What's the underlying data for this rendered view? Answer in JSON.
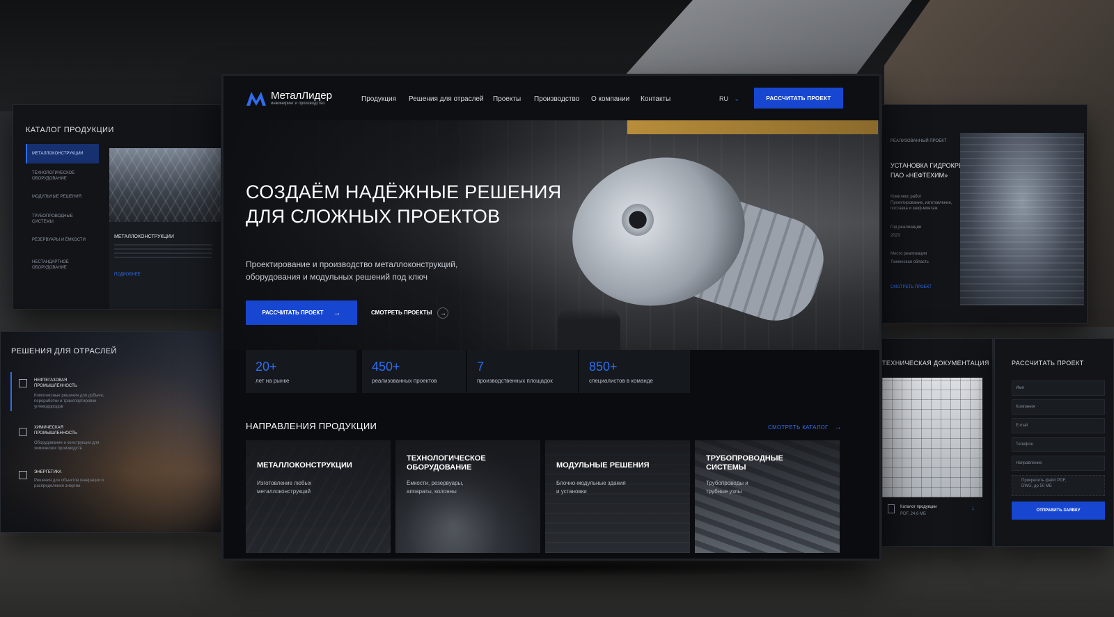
{
  "brand": {
    "name": "МеталЛидер",
    "tagline": "инжиниринг и производство",
    "accent": "#1747d0"
  },
  "nav": {
    "items": [
      "Продукция",
      "Решения для отраслей",
      "Проекты",
      "Производство",
      "О компании",
      "Контакты"
    ],
    "lang": "RU",
    "cta": "РАССЧИТАТЬ ПРОЕКТ"
  },
  "hero": {
    "title": "СОЗДАЁМ НАДЁЖНЫЕ РЕШЕНИЯ ДЛЯ СЛОЖНЫХ ПРОЕКТОВ",
    "lead": "Проектирование и производство металлоконструкций, оборудования и модульных решений под ключ",
    "primary": "РАССЧИТАТЬ ПРОЕКТ",
    "secondary": "СМОТРЕТЬ ПРОЕКТЫ"
  },
  "stats": [
    {
      "value": "20+",
      "label": "лет на рынке"
    },
    {
      "value": "450+",
      "label": "реализованных проектов"
    },
    {
      "value": "7",
      "label": "производственных площадок"
    },
    {
      "value": "850+",
      "label": "специалистов в команде"
    }
  ],
  "products": {
    "title": "НАПРАВЛЕНИЯ ПРОДУКЦИИ",
    "catalog_link": "СМОТРЕТЬ КАТАЛОГ",
    "cards": [
      {
        "title": "МЕТАЛЛОКОНСТРУКЦИИ",
        "desc": "Изготовление любых металлоконструкций"
      },
      {
        "title": "ТЕХНОЛОГИЧЕСКОЕ ОБОРУДОВАНИЕ",
        "desc": "Ёмкости, резервуары, аппараты, колонны"
      },
      {
        "title": "МОДУЛЬНЫЕ РЕШЕНИЯ",
        "desc": "Блочно-модульные здания и установки"
      },
      {
        "title": "ТРУБОПРОВОДНЫЕ СИСТЕМЫ",
        "desc": "Трубопроводы и трубные узлы"
      }
    ]
  },
  "catalog_panel": {
    "title": "КАТАЛОГ ПРОДУКЦИИ",
    "items": [
      "МЕТАЛЛОКОНСТРУКЦИИ",
      "ТЕХНОЛОГИЧЕСКОЕ ОБОРУДОВАНИЕ",
      "МОДУЛЬНЫЕ РЕШЕНИЯ",
      "ТРУБОПРОВОДНЫЕ СИСТЕМЫ",
      "РЕЗЕРВУАРЫ И ЁМКОСТИ",
      "НЕСТАНДАРТНОЕ ОБОРУДОВАНИЕ"
    ],
    "card_title": "МЕТАЛЛОКОНСТРУКЦИИ",
    "more": "ПОДРОБНЕЕ"
  },
  "industries_panel": {
    "title": "РЕШЕНИЯ ДЛЯ ОТРАСЛЕЙ",
    "items": [
      {
        "title": "НЕФТЕГАЗОВАЯ ПРОМЫШЛЕННОСТЬ",
        "desc": "Комплексные решения для добычи, переработки и транспортировки углеводородов"
      },
      {
        "title": "ХИМИЧЕСКАЯ ПРОМЫШЛЕННОСТЬ",
        "desc": "Оборудование и конструкции для химических производств"
      },
      {
        "title": "ЭНЕРГЕТИКА",
        "desc": "Решения для объектов генерации и распределения энергии"
      }
    ]
  },
  "project_panel": {
    "label": "РЕАЛИЗОВАННЫЙ ПРОЕКТ",
    "title": "УСТАНОВКА ГИДРОКРЕКИНГА ПАО «НЕФТЕХИМ»",
    "scope_label": "Комплекс работ",
    "scope": "Проектирование, изготовление, поставка и шеф-монтаж",
    "year_label": "Год реализации",
    "year": "2023",
    "place_label": "Место реализации",
    "place": "Тюменская область",
    "link": "СМОТРЕТЬ ПРОЕКТ"
  },
  "docs_panel": {
    "title": "ТЕХНИЧЕСКАЯ ДОКУМЕНТАЦИЯ",
    "file": "Каталог продукции",
    "meta": "PDF, 24.6 МБ"
  },
  "form_panel": {
    "title": "РАССЧИТАТЬ ПРОЕКТ",
    "fields": [
      "Имя",
      "Компания",
      "E-mail",
      "Телефон",
      "Направление"
    ],
    "attach": "Прикрепить файл PDF, DWG, до 50 МБ",
    "submit": "ОТПРАВИТЬ ЗАЯВКУ"
  }
}
